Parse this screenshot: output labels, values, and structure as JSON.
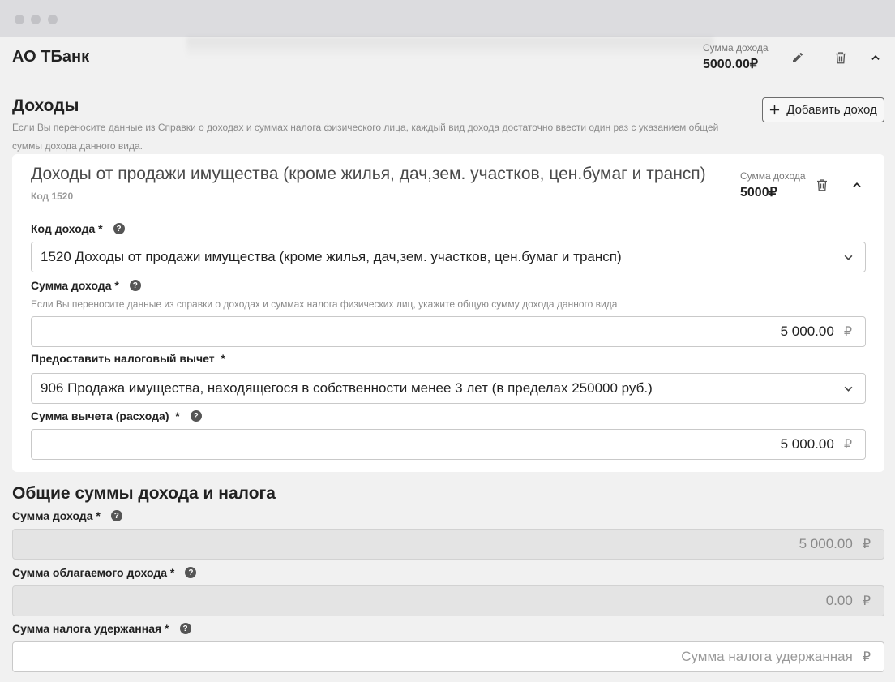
{
  "header": {
    "company": "АО ТБанк",
    "sum_label": "Сумма дохода",
    "sum_value": "5000.00₽"
  },
  "incomes": {
    "title": "Доходы",
    "description": "Если Вы переносите данные из Справки о доходах и суммах налога физического лица, каждый вид дохода достаточно ввести один раз с указанием общей суммы дохода данного вида.",
    "add_button": "Добавить доход"
  },
  "card": {
    "title": "Доходы от продажи имущества (кроме жилья, дач,зем. участков, цен.бумаг и трансп)",
    "code": "Код 1520",
    "sum_label": "Сумма дохода",
    "sum_value": "5000₽",
    "income_code_label": "Код дохода *",
    "income_code_value": "1520 Доходы от продажи имущества (кроме жилья, дач,зем. участков, цен.бумаг и трансп)",
    "income_sum_label": "Сумма дохода *",
    "income_sum_hint": "Если Вы переносите данные из справки о доходах и суммах налога физических лиц, укажите общую сумму дохода данного вида",
    "income_sum_value": "5 000.00",
    "deduction_label": "Предоставить налоговый вычет  *",
    "deduction_value": "906 Продажа имущества, находящегося в собственности менее 3 лет (в пределах 250000 руб.)",
    "deduction_sum_label": "Сумма вычета (расхода)  *",
    "deduction_sum_value": "5 000.00",
    "currency": "₽"
  },
  "totals": {
    "title": "Общие суммы дохода и налога",
    "income_label": "Сумма дохода *",
    "income_value": "5 000.00",
    "taxable_label": "Сумма облагаемого дохода *",
    "taxable_value": "0.00",
    "withheld_label": "Сумма налога удержанная *",
    "withheld_placeholder": "Сумма налога удержанная",
    "currency": "₽"
  },
  "icons": {
    "edit": "pencil-icon",
    "delete": "trash-icon",
    "collapse": "chevron-up-icon",
    "add": "plus-icon",
    "help": "question-icon",
    "dropdown": "chevron-down-icon"
  }
}
